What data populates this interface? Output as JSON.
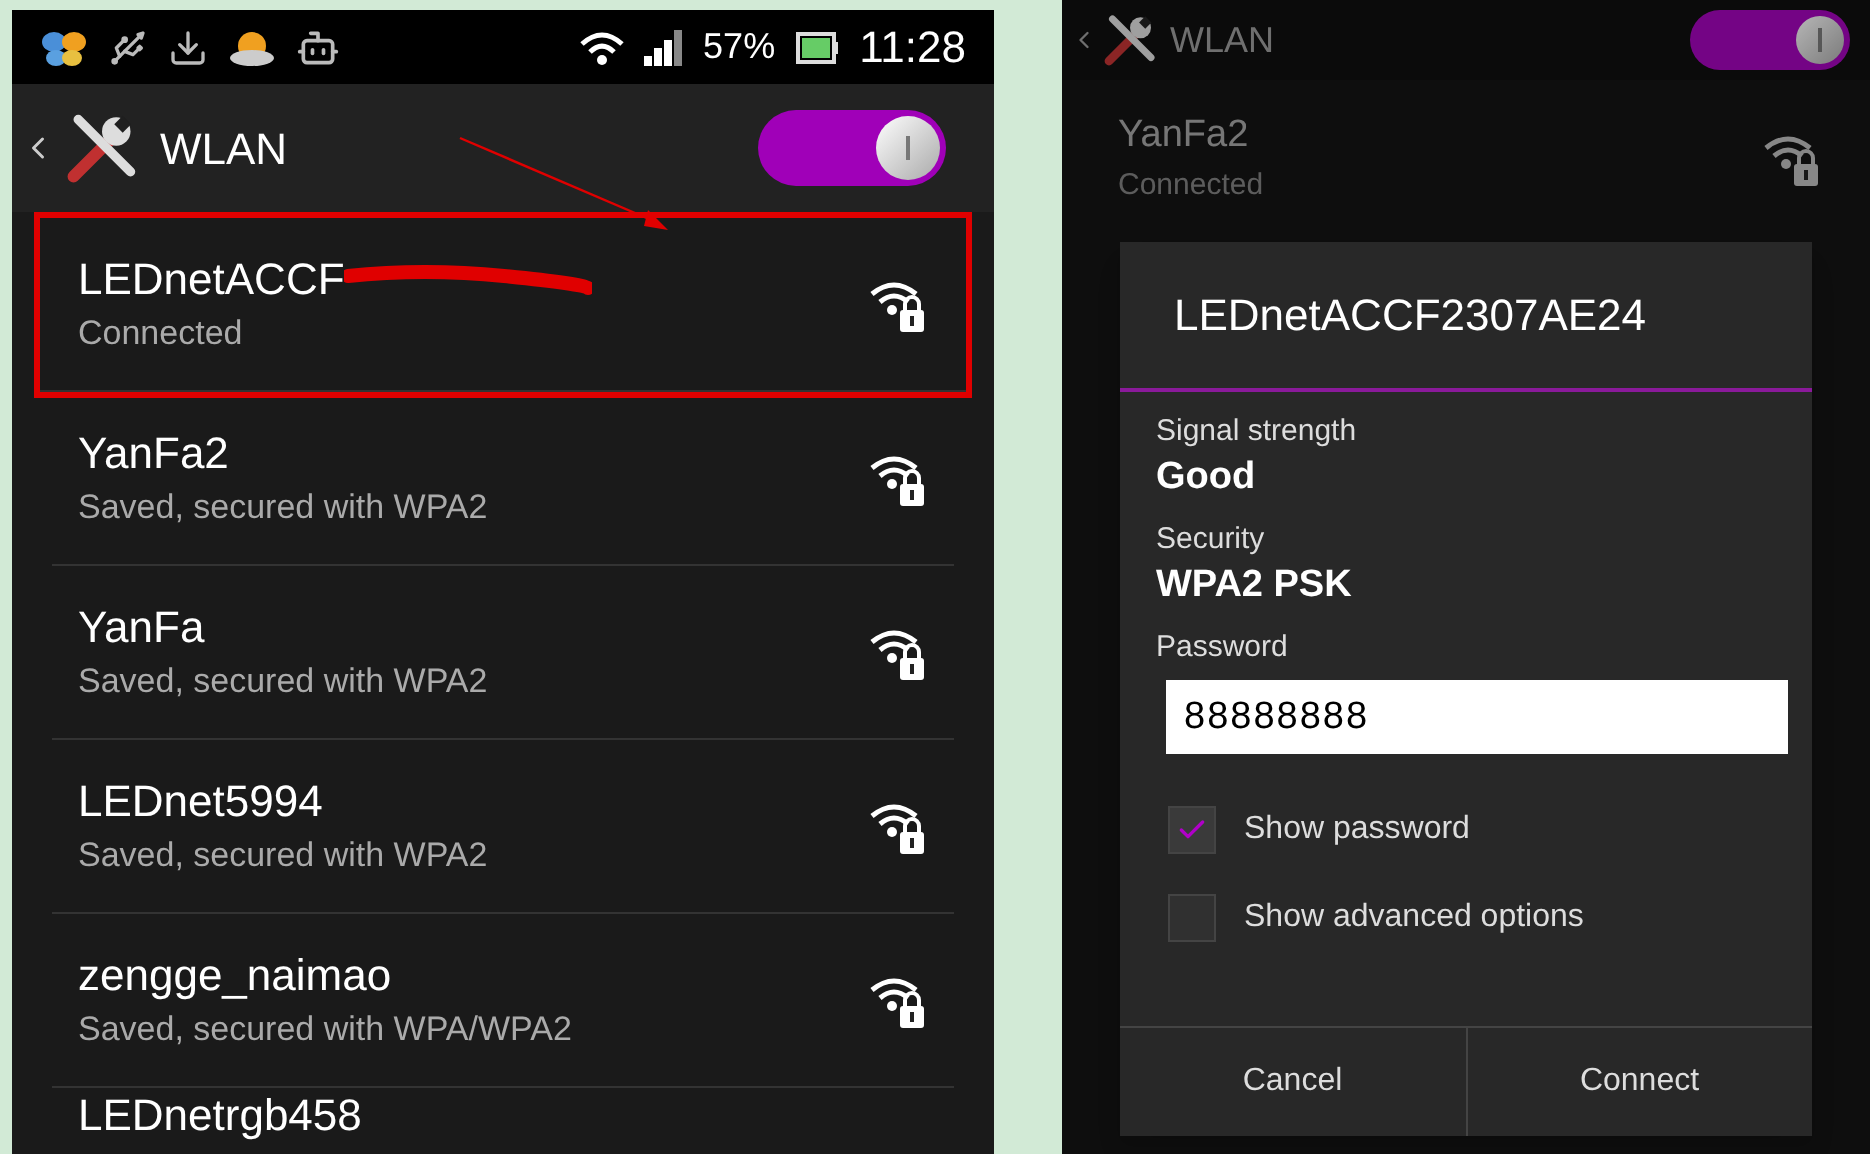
{
  "left_screen": {
    "status_bar": {
      "battery": "57%",
      "time": "11:28"
    },
    "action_bar": {
      "title": "WLAN",
      "wlan_on": true
    },
    "networks": [
      {
        "name": "LEDnetACCF",
        "status": "Connected",
        "highlighted": true,
        "redacted": true
      },
      {
        "name": "YanFa2",
        "status": "Saved, secured with WPA2",
        "highlighted": false
      },
      {
        "name": "YanFa",
        "status": "Saved, secured with WPA2",
        "highlighted": false
      },
      {
        "name": "LEDnet5994",
        "status": "Saved, secured with WPA2",
        "highlighted": false
      },
      {
        "name": "zengge_naimao",
        "status": "Saved, secured with WPA/WPA2",
        "highlighted": false
      },
      {
        "name": "LEDnetrgb458",
        "highlighted": false
      }
    ]
  },
  "right_screen": {
    "action_bar": {
      "title": "WLAN",
      "wlan_on": true
    },
    "network": {
      "name": "YanFa2",
      "status": "Connected"
    },
    "dialog": {
      "title": "LEDnetACCF2307AE24",
      "fields": [
        {
          "label": "Signal strength",
          "value": "Good"
        },
        {
          "label": "Security",
          "value": "WPA2 PSK"
        }
      ],
      "password": {
        "label": "Password",
        "value": "88888888"
      },
      "options": [
        {
          "label": "Show password",
          "checked": true
        },
        {
          "label": "Show advanced options",
          "checked": false
        }
      ],
      "buttons": [
        "Cancel",
        "Connect"
      ]
    }
  }
}
